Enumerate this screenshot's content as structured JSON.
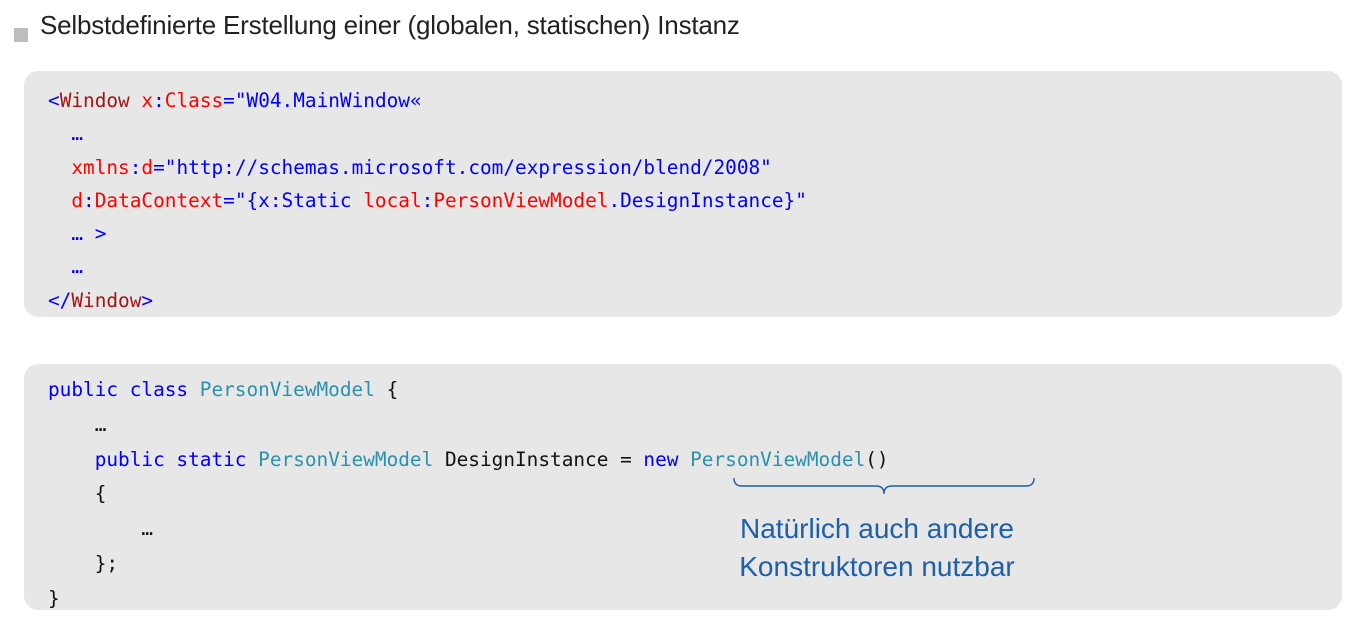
{
  "heading": "Selbstdefinierte Erstellung einer (globalen, statischen) Instanz",
  "xaml": {
    "l1_open": "<",
    "l1_tag": "Window",
    "l1_attr_ns": "x",
    "l1_colon": ":",
    "l1_attr": "Class",
    "l1_eq": "=",
    "l1_val": "\"W04.MainWindow«",
    "l2": "  …",
    "l3_ns": "  xmlns",
    "l3_colon": ":",
    "l3_attr": "d",
    "l3_eq": "=",
    "l3_val": "\"http://schemas.microsoft.com/expression/blend/2008\"",
    "l4_ns": "  d",
    "l4_colon": ":",
    "l4_attr": "DataContext",
    "l4_eq": "=",
    "l4_v1": "\"{x:Static ",
    "l4_v2": "local",
    "l4_v3": ":",
    "l4_v4": "PersonViewModel",
    "l4_v5": ".DesignInstance}\"",
    "l5_dots": "  … ",
    "l5_gt": ">",
    "l6": "  …",
    "l7_open": "</",
    "l7_tag": "Window",
    "l7_close": ">"
  },
  "csharp": {
    "l1_kw": "public class ",
    "l1_type": "PersonViewModel",
    "l1_rest": " {",
    "l2": "    …",
    "l3_indent": "    ",
    "l3_kw": "public static ",
    "l3_type": "PersonViewModel",
    "l3_mid": " DesignInstance = ",
    "l3_new": "new ",
    "l3_type2": "PersonViewModel",
    "l3_end": "()",
    "l4": "    {",
    "l5": "        …",
    "l6": "    };",
    "l7": "}"
  },
  "annotation": {
    "line1": "Natürlich auch andere",
    "line2": "Konstruktoren nutzbar"
  },
  "colors": {
    "xml_tag": "#a31515",
    "xml_attr": "#ff0000",
    "xml_value": "#0000ff",
    "keyword": "#0000ff",
    "type": "#2b91af",
    "annotation": "#1e5fa8",
    "box_bg": "#e7e7e7"
  }
}
